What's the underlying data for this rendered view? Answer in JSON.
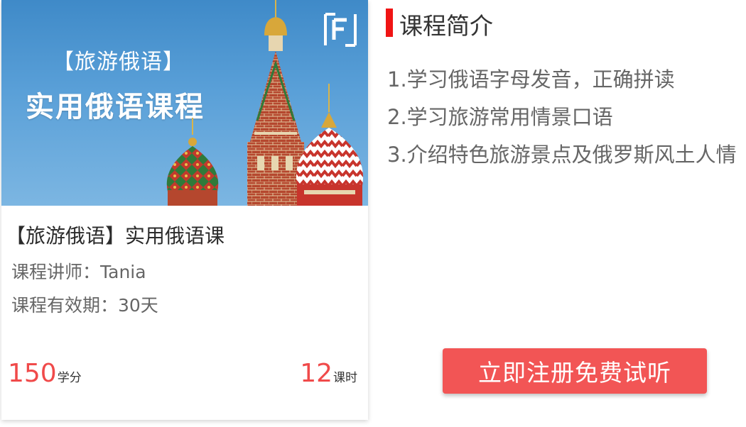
{
  "banner": {
    "subtitle": "【旅游俄语】",
    "title": "实用俄语课程",
    "logo_icon": "brand-letter-f-logo"
  },
  "course": {
    "title": "【旅游俄语】实用俄语课",
    "teacher": "课程讲师：Tania",
    "validity": "课程有效期：30天",
    "credits_value": "150",
    "credits_unit": "学分",
    "hours_value": "12",
    "hours_unit": "课时"
  },
  "intro": {
    "title": "课程简介",
    "items": [
      "1.学习俄语字母发音，正确拼读",
      "2.学习旅游常用情景口语",
      "3.介绍特色旅游景点及俄罗斯风土人情"
    ]
  },
  "cta": {
    "label": "立即注册免费试听"
  },
  "colors": {
    "accent_red": "#f01414",
    "price_red": "#f04a4a",
    "button_bg": "#f25555",
    "sky_blue": "#4a94d0"
  }
}
